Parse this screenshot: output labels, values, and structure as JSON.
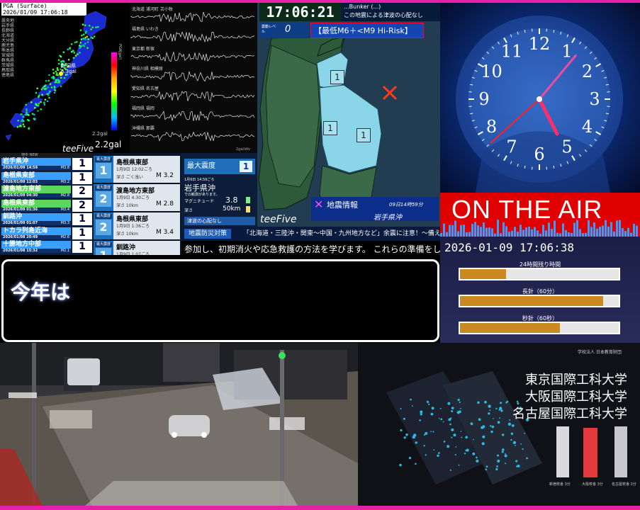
{
  "pga": {
    "header_title": "PGA (Surface)",
    "header_time": "2026/01/09 17:06:18",
    "region_list": [
      "震央地",
      "岩手県",
      "長野県",
      "北海道",
      "大分県",
      "鹿児島",
      "熊本県",
      "宮城県",
      "群馬県",
      "茨城県",
      "鳥取県",
      "徳島県"
    ],
    "peak_label": "新潟県",
    "peak_value": "6.3gal",
    "legend_label": "PGA[gal]",
    "scale_label": "2.2gal",
    "value": "2.2gal"
  },
  "waveforms": {
    "stations": [
      "北海道 浦河町 苫小牧",
      "福島県 いわき",
      "東京都 新宿",
      "神奈川県 相模原",
      "愛知県 名古屋",
      "福岡県 福岡",
      "沖縄県 那覇"
    ],
    "footer": "2gal/div"
  },
  "intensity_list": {
    "header": "地中 NEW",
    "brand": "teeFive",
    "items": [
      {
        "name": "岩手県沖",
        "date": "2026/01/09 14:59",
        "mag": "M3.8",
        "intensity": "1"
      },
      {
        "name": "島根県東部",
        "date": "2026/01/09 12:03",
        "mag": "M3.2",
        "intensity": "1"
      },
      {
        "name": "渡島地方東部",
        "date": "2026/01/09 04:30",
        "mag": "M2.8",
        "intensity": "2"
      },
      {
        "name": "島根県東部",
        "date": "2026/01/09 01:36",
        "mag": "M3.4",
        "intensity": "2"
      },
      {
        "name": "釧路沖",
        "date": "2026/01/09 01:07",
        "mag": "M3.3",
        "intensity": "1"
      },
      {
        "name": "トカラ列島近海",
        "date": "2026/01/08 20:49",
        "mag": "M2.6",
        "intensity": "1"
      },
      {
        "name": "十勝地方中部",
        "date": "2026/01/08 15:32",
        "mag": "M2.1",
        "intensity": "1"
      }
    ]
  },
  "quake_cards": [
    {
      "label": "最大震度",
      "intensity": "1",
      "name": "島根県東部",
      "date": "1月9日 12:02ごろ",
      "depth": "深さ ごく浅い",
      "mag": "M 3.2"
    },
    {
      "label": "最大震度",
      "intensity": "2",
      "name": "渡島地方東部",
      "date": "1月9日 4:30ごろ",
      "depth": "深さ 10km",
      "mag": "M 2.8"
    },
    {
      "label": "最大震度",
      "intensity": "2",
      "name": "島根県東部",
      "date": "1月9日 1:36ごろ",
      "depth": "深さ 10km",
      "mag": "M 3.4"
    },
    {
      "label": "最大震度",
      "intensity": "1",
      "name": "釧路沖",
      "date": "1月9日 1:07ごろ",
      "depth": "",
      "mag": ""
    }
  ],
  "latest": {
    "title": "最大震度",
    "intensity": "1",
    "date": "1月9日 14:59ごろ",
    "name": "岩手県沖",
    "note": "での観測があります。",
    "mag_label": "マグニチュード",
    "mag": "3.8",
    "depth_label": "深さ",
    "depth": "50km",
    "tsunami": "津波の心配なし"
  },
  "map": {
    "clock": "17:06:21",
    "note_line1": "...Bunker (...)",
    "note_line2": "この地震による津波の心配なし",
    "level_label": "震動レベル",
    "level_value": "0",
    "risk": "【最低M6＋<M9 Hi-Risk】",
    "intensities": [
      "1",
      "1",
      "1"
    ],
    "brand": "teeFive",
    "info_title": "地震情報",
    "info_time": "09日14時59分",
    "info_region": "岩手県沖"
  },
  "ticker1": {
    "label": "地震防災対策",
    "text": "「北海道・三陸沖・関東〜中国・九州地方など」余震に注意！〜備えを〜"
  },
  "ticker2": {
    "text": "参加し、初期消火や応急救護の方法を学びます。 これらの準備をして"
  },
  "subtitle": {
    "text": "今年は"
  },
  "clock": {
    "numerals": [
      "12",
      "1",
      "2",
      "3",
      "4",
      "5",
      "6",
      "7",
      "8",
      "9",
      "10",
      "11"
    ],
    "hour": 17,
    "minute": 6,
    "second": 38
  },
  "onair": {
    "text": "ON THE AIR"
  },
  "progress": {
    "datetime": "2026-01-09 17:06:38",
    "bars": [
      {
        "label": "24時間残り時間",
        "fill": 0.29
      },
      {
        "label": "長針（60分）",
        "fill": 0.9
      },
      {
        "label": "秒針（60秒）",
        "fill": 0.63
      }
    ]
  },
  "ad": {
    "small": "学校法人 日本教育財団",
    "lines": [
      "東京国際工科大学",
      "大阪国際工科大学",
      "名古屋国際工科大学"
    ],
    "captions": [
      "新宿校舎 3分",
      "大阪校舎 3分",
      "名古屋校舎 2分"
    ]
  }
}
